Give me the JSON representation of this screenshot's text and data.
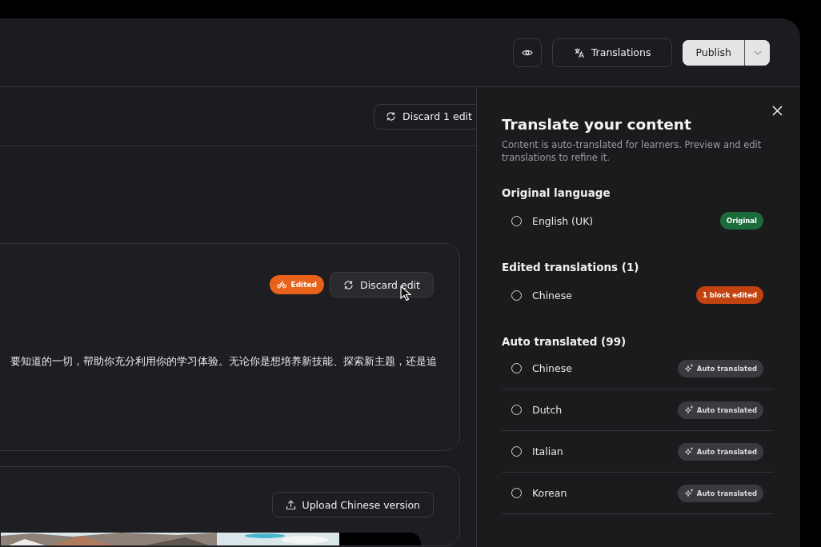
{
  "top_bar": {
    "preview_button": {
      "kind": "eye"
    },
    "translations_button": {
      "label": "Translations"
    },
    "publish_button": {
      "label": "Publish"
    }
  },
  "editor": {
    "discard_all_button": {
      "label": "Discard 1 edit"
    },
    "cards": [
      {
        "kind": "text",
        "badge": {
          "label": "Edited"
        },
        "action": {
          "label": "Discard edit",
          "hovered": true
        },
        "body": "要知道的一切，帮助你充分利用你的学习体验。无论你是想培养新技能、探索新主题，还是追"
      },
      {
        "kind": "media",
        "action": {
          "label": "Upload Chinese version"
        }
      }
    ]
  },
  "panel": {
    "title": "Translate your content",
    "description": "Content is auto-translated for learners. Preview and edit translations to refine it.",
    "sections": [
      {
        "heading": "Original language",
        "items": [
          {
            "label": "English (UK)",
            "selected": false,
            "badge": {
              "kind": "original",
              "label": "Original"
            }
          }
        ]
      },
      {
        "heading": "Edited translations (1)",
        "items": [
          {
            "label": "Chinese",
            "selected": false,
            "badge": {
              "kind": "edited",
              "label": "1 block edited"
            }
          }
        ]
      },
      {
        "heading": "Auto translated (99)",
        "items": [
          {
            "label": "Chinese",
            "selected": false,
            "badge": {
              "kind": "auto",
              "label": "Auto translated"
            }
          },
          {
            "label": "Dutch",
            "selected": false,
            "badge": {
              "kind": "auto",
              "label": "Auto translated"
            }
          },
          {
            "label": "Italian",
            "selected": false,
            "badge": {
              "kind": "auto",
              "label": "Auto translated"
            }
          },
          {
            "label": "Korean",
            "selected": false,
            "badge": {
              "kind": "auto",
              "label": "Auto translated"
            }
          }
        ]
      }
    ]
  }
}
